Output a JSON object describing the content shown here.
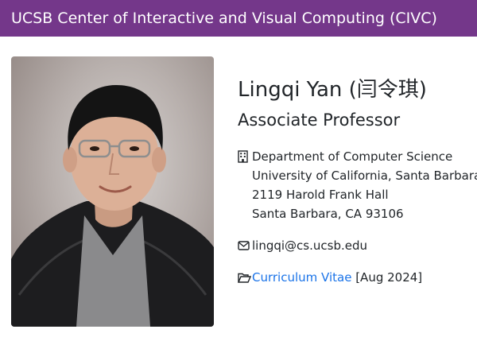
{
  "navbar": {
    "brand": "UCSB Center of Interactive and Visual Computing (CIVC)"
  },
  "profile": {
    "photo_alt": "Portrait photo",
    "name": "Lingqi Yan (闫令琪)",
    "title": "Associate Professor",
    "address_lines": [
      "Department of Computer Science",
      "University of California, Santa Barbara",
      "2119 Harold Frank Hall",
      "Santa Barbara, CA 93106"
    ],
    "email": "lingqi@cs.ucsb.edu",
    "cv_link": "Curriculum Vitae",
    "cv_date": " [Aug 2024]"
  },
  "icons": {
    "address": "building-icon",
    "email": "envelope-icon",
    "cv": "folder-open-icon"
  },
  "colors": {
    "navbar": "#74378a",
    "link": "#1a73e8",
    "text": "#212529"
  }
}
